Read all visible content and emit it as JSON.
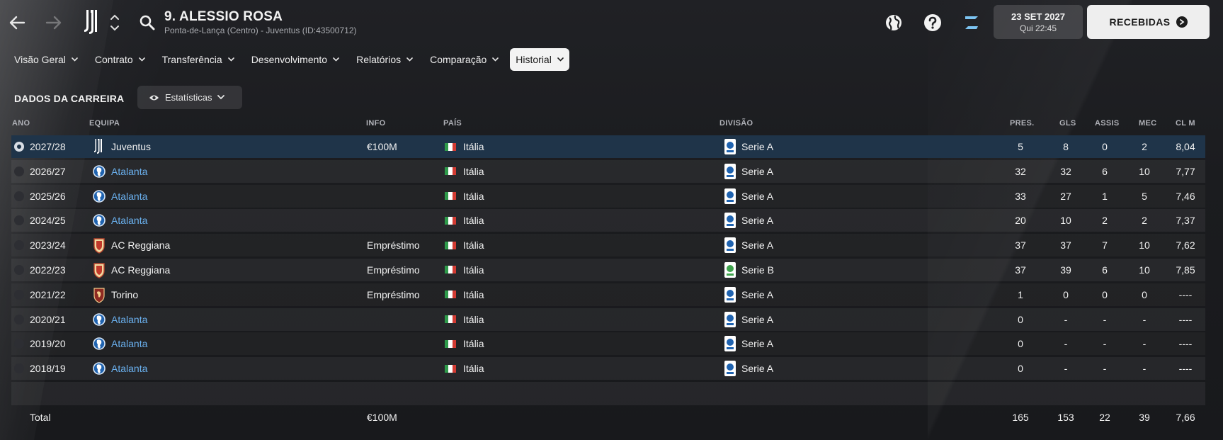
{
  "header": {
    "player_name": "9. ALESSIO ROSA",
    "player_sub": "Ponta-de-Lança (Centro) - Juventus (ID:43500712)",
    "date_main": "23 SET 2027",
    "date_sub": "Qui 22:45",
    "received_label": "RECEBIDAS"
  },
  "tabs": [
    {
      "label": "Visão Geral",
      "active": false
    },
    {
      "label": "Contrato",
      "active": false
    },
    {
      "label": "Transferência",
      "active": false
    },
    {
      "label": "Desenvolvimento",
      "active": false
    },
    {
      "label": "Relatórios",
      "active": false
    },
    {
      "label": "Comparação",
      "active": false
    },
    {
      "label": "Historial",
      "active": true
    }
  ],
  "section": {
    "title": "DADOS DA CARREIRA",
    "view_label": "Estatísticas"
  },
  "columns": {
    "year": "ANO",
    "team": "EQUIPA",
    "info": "INFO",
    "country": "PAÍS",
    "division": "DIVISÃO",
    "pres": "PRES.",
    "gls": "GLS",
    "assis": "ASSIS",
    "mec": "MEC",
    "clm": "CL M"
  },
  "rows": [
    {
      "year": "2027/28",
      "team": "Juventus",
      "crest": "juventus",
      "link": false,
      "info": "€100M",
      "country": "Itália",
      "division": "Serie A",
      "div_logo": "serie-a",
      "pres": "5",
      "gls": "8",
      "assis": "0",
      "mec": "2",
      "clm": "8,04",
      "selected": true
    },
    {
      "year": "2026/27",
      "team": "Atalanta",
      "crest": "atalanta",
      "link": true,
      "info": "",
      "country": "Itália",
      "division": "Serie A",
      "div_logo": "serie-a",
      "pres": "32",
      "gls": "32",
      "assis": "6",
      "mec": "10",
      "clm": "7,77",
      "selected": false
    },
    {
      "year": "2025/26",
      "team": "Atalanta",
      "crest": "atalanta",
      "link": true,
      "info": "",
      "country": "Itália",
      "division": "Serie A",
      "div_logo": "serie-a",
      "pres": "33",
      "gls": "27",
      "assis": "1",
      "mec": "5",
      "clm": "7,46",
      "selected": false
    },
    {
      "year": "2024/25",
      "team": "Atalanta",
      "crest": "atalanta",
      "link": true,
      "info": "",
      "country": "Itália",
      "division": "Serie A",
      "div_logo": "serie-a",
      "pres": "20",
      "gls": "10",
      "assis": "2",
      "mec": "2",
      "clm": "7,37",
      "selected": false
    },
    {
      "year": "2023/24",
      "team": "AC Reggiana",
      "crest": "reggiana",
      "link": false,
      "info": "Empréstimo",
      "country": "Itália",
      "division": "Serie A",
      "div_logo": "serie-a",
      "pres": "37",
      "gls": "37",
      "assis": "7",
      "mec": "10",
      "clm": "7,62",
      "selected": false
    },
    {
      "year": "2022/23",
      "team": "AC Reggiana",
      "crest": "reggiana",
      "link": false,
      "info": "Empréstimo",
      "country": "Itália",
      "division": "Serie B",
      "div_logo": "serie-b",
      "pres": "37",
      "gls": "39",
      "assis": "6",
      "mec": "10",
      "clm": "7,85",
      "selected": false
    },
    {
      "year": "2021/22",
      "team": "Torino",
      "crest": "torino",
      "link": false,
      "info": "Empréstimo",
      "country": "Itália",
      "division": "Serie A",
      "div_logo": "serie-a",
      "pres": "1",
      "gls": "0",
      "assis": "0",
      "mec": "0",
      "clm": "----",
      "selected": false
    },
    {
      "year": "2020/21",
      "team": "Atalanta",
      "crest": "atalanta",
      "link": true,
      "info": "",
      "country": "Itália",
      "division": "Serie A",
      "div_logo": "serie-a",
      "pres": "0",
      "gls": "-",
      "assis": "-",
      "mec": "-",
      "clm": "----",
      "selected": false
    },
    {
      "year": "2019/20",
      "team": "Atalanta",
      "crest": "atalanta",
      "link": true,
      "info": "",
      "country": "Itália",
      "division": "Serie A",
      "div_logo": "serie-a",
      "pres": "0",
      "gls": "-",
      "assis": "-",
      "mec": "-",
      "clm": "----",
      "selected": false
    },
    {
      "year": "2018/19",
      "team": "Atalanta",
      "crest": "atalanta",
      "link": true,
      "info": "",
      "country": "Itália",
      "division": "Serie A",
      "div_logo": "serie-a",
      "pres": "0",
      "gls": "-",
      "assis": "-",
      "mec": "-",
      "clm": "----",
      "selected": false
    }
  ],
  "total": {
    "label": "Total",
    "info": "€100M",
    "pres": "165",
    "gls": "153",
    "assis": "22",
    "mec": "39",
    "clm": "7,66"
  },
  "colors": {
    "accent_link": "#6ab0ee",
    "selected_row": "#1f3449",
    "z_icon": "#7cc4f2"
  }
}
